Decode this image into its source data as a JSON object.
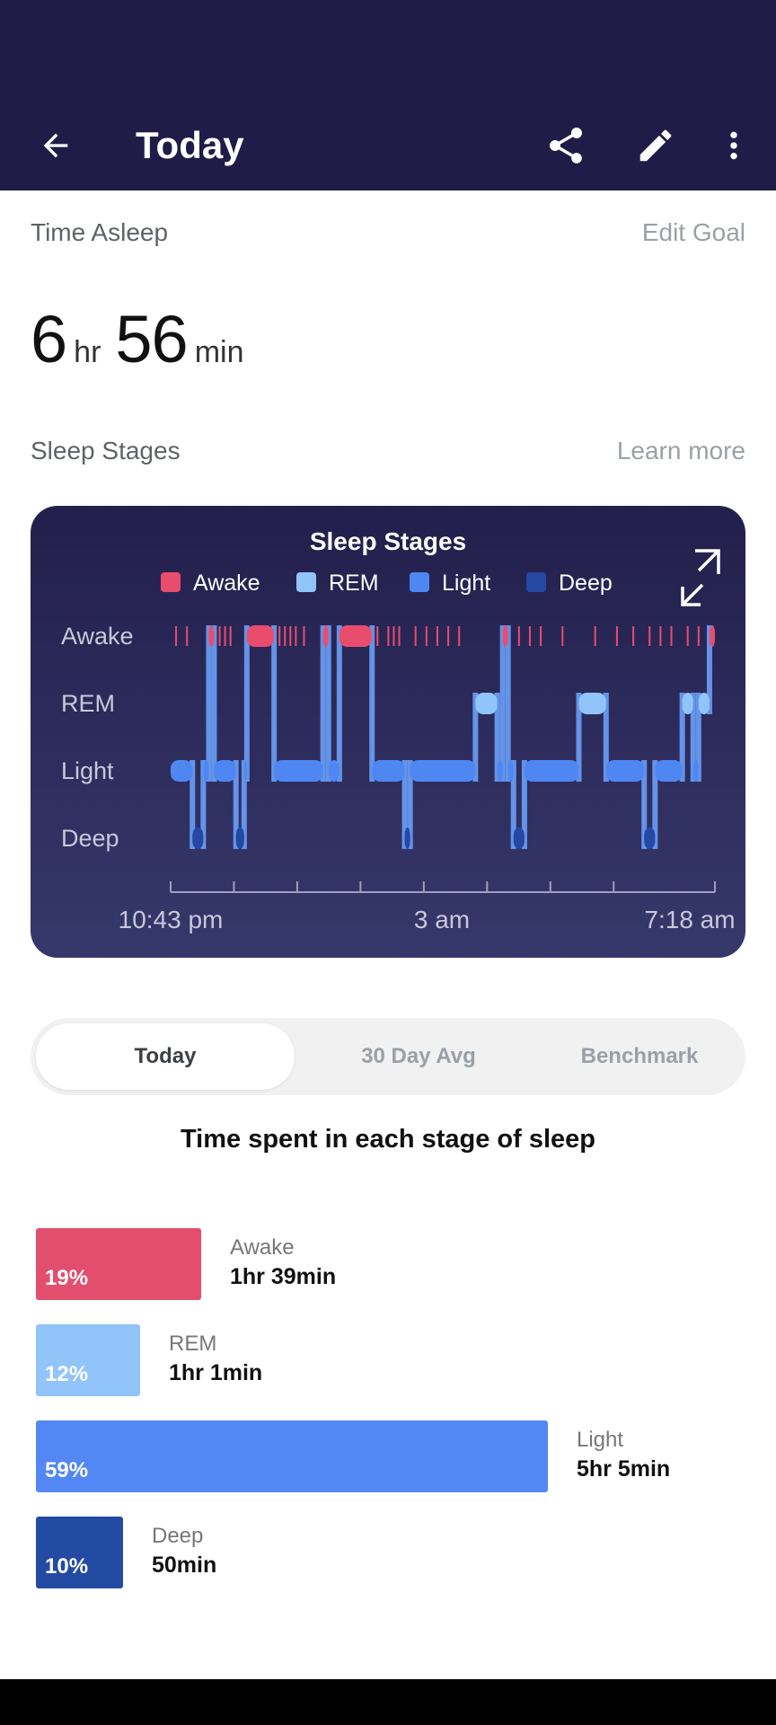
{
  "appbar": {
    "title": "Today"
  },
  "time_asleep": {
    "label": "Time Asleep",
    "edit_goal": "Edit Goal",
    "hours": "6",
    "hours_unit": "hr",
    "minutes": "56",
    "minutes_unit": "min"
  },
  "sleep_stages_section": {
    "label": "Sleep Stages",
    "learn_more": "Learn more"
  },
  "chart_data": {
    "type": "step-timeline",
    "title": "Sleep Stages",
    "legend": [
      {
        "name": "Awake",
        "color": "#e94d6e"
      },
      {
        "name": "REM",
        "color": "#91c4f9"
      },
      {
        "name": "Light",
        "color": "#4f87f2"
      },
      {
        "name": "Deep",
        "color": "#2548a3"
      }
    ],
    "y_levels": [
      "Awake",
      "REM",
      "Light",
      "Deep"
    ],
    "x_tick_labels": [
      "10:43 pm",
      "3 am",
      "7:18 am"
    ],
    "start": "10:43 pm",
    "end": "7:18 am",
    "segments": [
      [
        "Light",
        0.0,
        0.04
      ],
      [
        "Deep",
        0.04,
        0.06
      ],
      [
        "Light",
        0.06,
        0.07
      ],
      [
        "Awake",
        0.07,
        0.08
      ],
      [
        "Light",
        0.08,
        0.12
      ],
      [
        "Deep",
        0.12,
        0.135
      ],
      [
        "Light",
        0.135,
        0.14
      ],
      [
        "Awake",
        0.14,
        0.19
      ],
      [
        "Light",
        0.19,
        0.28
      ],
      [
        "Awake",
        0.28,
        0.29
      ],
      [
        "Light",
        0.29,
        0.31
      ],
      [
        "Awake",
        0.31,
        0.37
      ],
      [
        "Light",
        0.37,
        0.43
      ],
      [
        "Deep",
        0.43,
        0.44
      ],
      [
        "Light",
        0.44,
        0.56
      ],
      [
        "REM",
        0.56,
        0.6
      ],
      [
        "Light",
        0.6,
        0.61
      ],
      [
        "Awake",
        0.61,
        0.62
      ],
      [
        "Light",
        0.62,
        0.63
      ],
      [
        "Deep",
        0.63,
        0.65
      ],
      [
        "Light",
        0.65,
        0.75
      ],
      [
        "REM",
        0.75,
        0.8
      ],
      [
        "Light",
        0.8,
        0.87
      ],
      [
        "Deep",
        0.87,
        0.89
      ],
      [
        "Light",
        0.89,
        0.94
      ],
      [
        "REM",
        0.94,
        0.96
      ],
      [
        "Light",
        0.96,
        0.97
      ],
      [
        "REM",
        0.97,
        0.99
      ],
      [
        "Awake",
        0.99,
        1.0
      ]
    ],
    "awake_blips": [
      0.01,
      0.03,
      0.09,
      0.1,
      0.11,
      0.2,
      0.21,
      0.22,
      0.23,
      0.245,
      0.38,
      0.4,
      0.41,
      0.42,
      0.45,
      0.47,
      0.49,
      0.51,
      0.53,
      0.64,
      0.66,
      0.68,
      0.72,
      0.78,
      0.82,
      0.85,
      0.88,
      0.9,
      0.92,
      0.95,
      0.97
    ]
  },
  "tabs": [
    {
      "label": "Today",
      "active": true
    },
    {
      "label": "30 Day Avg",
      "active": false
    },
    {
      "label": "Benchmark",
      "active": false
    }
  ],
  "stage_summary": {
    "heading": "Time spent in each stage of sleep",
    "stages": [
      {
        "name": "Awake",
        "percent": 19,
        "pct_label": "19%",
        "duration": "1hr 39min",
        "color": "#e24e6e"
      },
      {
        "name": "REM",
        "percent": 12,
        "pct_label": "12%",
        "duration": "1hr 1min",
        "color": "#91c4f9"
      },
      {
        "name": "Light",
        "percent": 59,
        "pct_label": "59%",
        "duration": "5hr 5min",
        "color": "#5388f4"
      },
      {
        "name": "Deep",
        "percent": 10,
        "pct_label": "10%",
        "duration": "50min",
        "color": "#244ba3"
      }
    ]
  }
}
